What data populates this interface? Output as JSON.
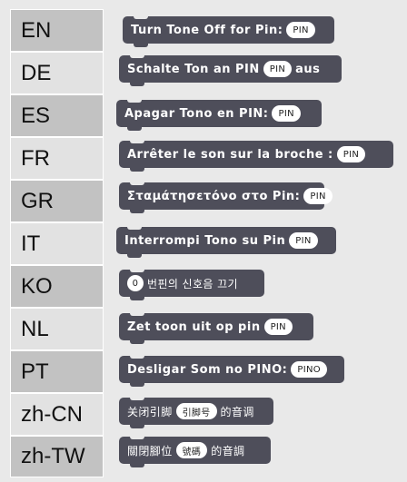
{
  "rows": [
    {
      "lang": "EN",
      "parts": [
        {
          "t": "Turn Tone Off for Pin:"
        },
        {
          "pill": "PIN"
        }
      ]
    },
    {
      "lang": "DE",
      "parts": [
        {
          "t": "Schalte Ton an PIN"
        },
        {
          "pill": "PIN"
        },
        {
          "t": "aus"
        }
      ]
    },
    {
      "lang": "ES",
      "parts": [
        {
          "t": "Apagar Tono en PIN:"
        },
        {
          "pill": "PIN"
        }
      ]
    },
    {
      "lang": "FR",
      "parts": [
        {
          "t": "Arrêter le son sur la broche :"
        },
        {
          "pill": "PIN"
        }
      ]
    },
    {
      "lang": "GR",
      "parts": [
        {
          "t": "Σταμάτησετόνο στο Pin:"
        },
        {
          "pill": "PIN"
        }
      ]
    },
    {
      "lang": "IT",
      "parts": [
        {
          "t": "Interrompi Tono su Pin"
        },
        {
          "pill": "PIN"
        }
      ]
    },
    {
      "lang": "KO",
      "parts": [
        {
          "pill": "0"
        },
        {
          "t": "번핀의 신호음 끄기"
        }
      ]
    },
    {
      "lang": "NL",
      "parts": [
        {
          "t": "Zet toon uit op pin"
        },
        {
          "pill": "PIN"
        }
      ]
    },
    {
      "lang": "PT",
      "parts": [
        {
          "t": "Desligar Som no PINO:"
        },
        {
          "pill": "PINO"
        }
      ]
    },
    {
      "lang": "zh-CN",
      "parts": [
        {
          "t": "关闭引脚"
        },
        {
          "pill": "引脚号"
        },
        {
          "t": "的音调"
        }
      ]
    },
    {
      "lang": "zh-TW",
      "parts": [
        {
          "t": "關閉腳位"
        },
        {
          "pill": "號碼"
        },
        {
          "t": "的音調"
        }
      ]
    }
  ],
  "colors": {
    "block": "#4e4e5a",
    "lang_dark": "#c2c2c2",
    "lang_light": "#e2e2e2",
    "background": "#e9e9e9"
  }
}
